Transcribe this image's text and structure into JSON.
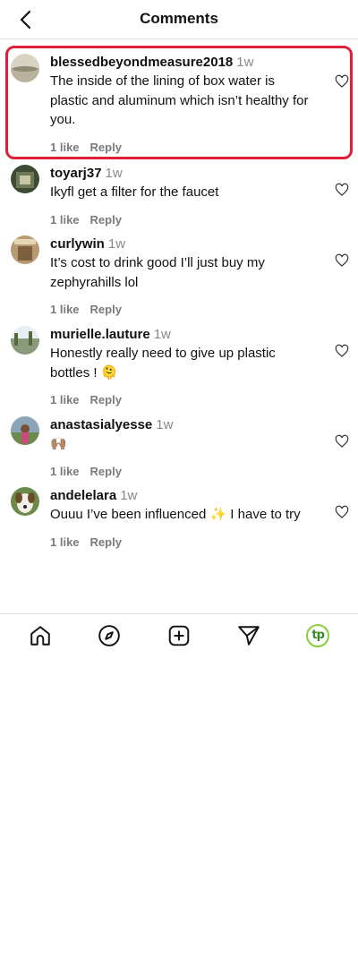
{
  "header": {
    "title": "Comments"
  },
  "comments": [
    {
      "username": "blessedbeyondmeasure2018",
      "time": "1w",
      "text": "The inside of the lining of box water is plastic and aluminum which isn’t healthy for you.",
      "likes": "1 like",
      "reply": "Reply"
    },
    {
      "username": "toyarj37",
      "time": "1w",
      "text": "Ikyfl get a filter for the faucet",
      "likes": "1 like",
      "reply": "Reply"
    },
    {
      "username": "curlywin",
      "time": "1w",
      "text": "It’s cost to drink good I’ll just buy my zephyrahills lol",
      "likes": "1 like",
      "reply": "Reply"
    },
    {
      "username": "murielle.lauture",
      "time": "1w",
      "text": "Honestly really need to give up plastic bottles ! 🫠",
      "likes": "1 like",
      "reply": "Reply"
    },
    {
      "username": "anastasialyesse",
      "time": "1w",
      "text": "🙌🏽",
      "likes": "1 like",
      "reply": "Reply"
    },
    {
      "username": "andelelara",
      "time": "1w",
      "text": "Ouuu I’ve been influenced ✨ I have to try",
      "likes": "1 like",
      "reply": "Reply"
    }
  ],
  "nav": {
    "profile_initials": "tp"
  },
  "colors": {
    "highlight": "#e0203a",
    "meta": "#7a7a7a",
    "accent_green": "#8ccd3a"
  }
}
